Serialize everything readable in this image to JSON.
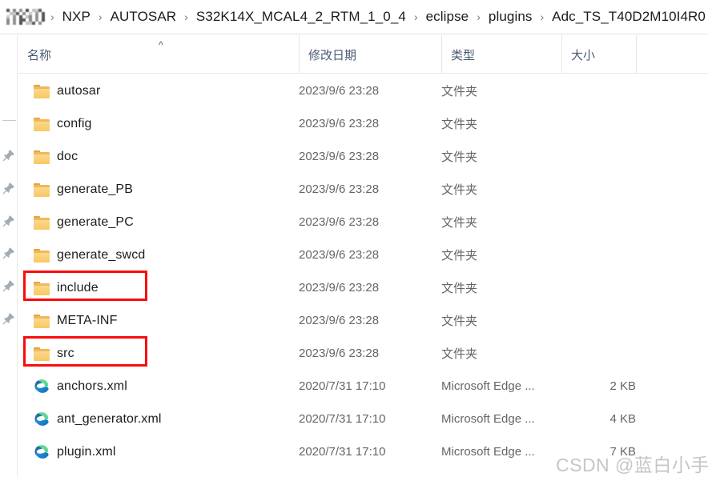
{
  "window": {
    "title": "Adc_TS_T40D2M10I4R0"
  },
  "breadcrumb": {
    "redacted_label": "redacted-path-segment",
    "separator": "›",
    "items": [
      {
        "label": "NXP"
      },
      {
        "label": "AUTOSAR"
      },
      {
        "label": "S32K14X_MCAL4_2_RTM_1_0_4"
      },
      {
        "label": "eclipse"
      },
      {
        "label": "plugins"
      },
      {
        "label": "Adc_TS_T40D2M10I4R0"
      }
    ]
  },
  "nav_pane": {
    "pin_icon_name": "pin-icon",
    "pin_count": 6
  },
  "columns": [
    {
      "key": "name",
      "label": "名称",
      "sorted": true,
      "sort_direction": "ascending"
    },
    {
      "key": "date",
      "label": "修改日期",
      "sorted": false,
      "sort_direction": ""
    },
    {
      "key": "type",
      "label": "类型",
      "sorted": false,
      "sort_direction": ""
    },
    {
      "key": "size",
      "label": "大小",
      "sorted": false,
      "sort_direction": ""
    }
  ],
  "sort_indicator_glyph": "^",
  "files": [
    {
      "name": "autosar",
      "date": "2023/9/6 23:28",
      "type": "文件夹",
      "size": "",
      "icon": "folder-icon",
      "highlighted": false
    },
    {
      "name": "config",
      "date": "2023/9/6 23:28",
      "type": "文件夹",
      "size": "",
      "icon": "folder-icon",
      "highlighted": false
    },
    {
      "name": "doc",
      "date": "2023/9/6 23:28",
      "type": "文件夹",
      "size": "",
      "icon": "folder-icon",
      "highlighted": false
    },
    {
      "name": "generate_PB",
      "date": "2023/9/6 23:28",
      "type": "文件夹",
      "size": "",
      "icon": "folder-icon",
      "highlighted": false
    },
    {
      "name": "generate_PC",
      "date": "2023/9/6 23:28",
      "type": "文件夹",
      "size": "",
      "icon": "folder-icon",
      "highlighted": false
    },
    {
      "name": "generate_swcd",
      "date": "2023/9/6 23:28",
      "type": "文件夹",
      "size": "",
      "icon": "folder-icon",
      "highlighted": false
    },
    {
      "name": "include",
      "date": "2023/9/6 23:28",
      "type": "文件夹",
      "size": "",
      "icon": "folder-icon",
      "highlighted": true
    },
    {
      "name": "META-INF",
      "date": "2023/9/6 23:28",
      "type": "文件夹",
      "size": "",
      "icon": "folder-icon",
      "highlighted": false
    },
    {
      "name": "src",
      "date": "2023/9/6 23:28",
      "type": "文件夹",
      "size": "",
      "icon": "folder-icon",
      "highlighted": true
    },
    {
      "name": "anchors.xml",
      "date": "2020/7/31 17:10",
      "type": "Microsoft Edge ...",
      "size": "2 KB",
      "icon": "edge-icon",
      "highlighted": false
    },
    {
      "name": "ant_generator.xml",
      "date": "2020/7/31 17:10",
      "type": "Microsoft Edge ...",
      "size": "4 KB",
      "icon": "edge-icon",
      "highlighted": false
    },
    {
      "name": "plugin.xml",
      "date": "2020/7/31 17:10",
      "type": "Microsoft Edge ...",
      "size": "7 KB",
      "icon": "edge-icon",
      "highlighted": false
    }
  ],
  "annotations": {
    "color": "#fb0b0b",
    "boxes": [
      {
        "target": "include",
        "name": "annotation-box-include"
      },
      {
        "target": "src",
        "name": "annotation-box-src"
      }
    ]
  },
  "watermark": {
    "text": "CSDN @蓝白小手套"
  },
  "colors": {
    "folder": "#f8c861",
    "edge_blue": "#0f6cbd",
    "edge_green": "#41c78a",
    "header_text": "#4a5a74",
    "body_text": "#1c1c1c",
    "meta_text": "#656565",
    "annotation": "#fb0b0b",
    "watermark": "#c6c6c6"
  }
}
